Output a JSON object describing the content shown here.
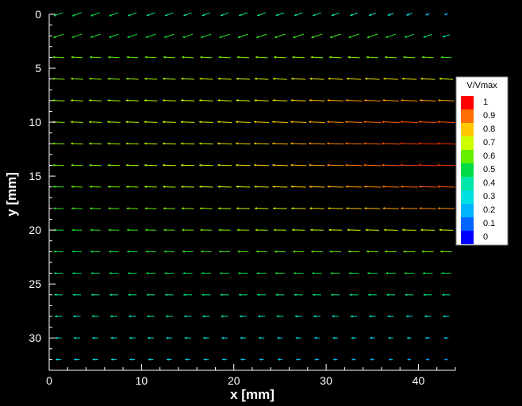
{
  "chart_data": {
    "type": "vector-field",
    "xlabel": "x [mm]",
    "ylabel": "y [mm]",
    "xlim": [
      0,
      44
    ],
    "ylim": [
      33,
      0
    ],
    "x_ticks": [
      0,
      10,
      20,
      30,
      40
    ],
    "y_ticks": [
      0,
      5,
      10,
      15,
      20,
      25,
      30
    ],
    "grid": false,
    "legend": {
      "title": "V/Vmax",
      "placement": "right",
      "levels": [
        "1",
        "0.9",
        "0.8",
        "0.7",
        "0.6",
        "0.5",
        "0.4",
        "0.3",
        "0.2",
        "0.1",
        "0"
      ],
      "colors": [
        "#ff0000",
        "#ff6e00",
        "#ffc800",
        "#ccff00",
        "#66ee00",
        "#00dd44",
        "#00e6aa",
        "#00e0e0",
        "#00b4ff",
        "#0066ff",
        "#0000ff"
      ]
    },
    "grid_x": [
      1,
      3,
      5,
      7,
      9,
      11,
      13,
      15,
      17,
      19,
      21,
      23,
      25,
      27,
      29,
      31,
      33,
      35,
      37,
      39,
      41,
      43
    ],
    "grid_y": [
      0,
      2,
      4,
      6,
      8,
      10,
      12,
      14,
      16,
      18,
      20,
      22,
      24,
      26,
      28,
      30,
      32
    ],
    "direction": "-x",
    "speed_note_rows": [
      [
        0.48,
        0.49,
        0.49,
        0.48,
        0.45,
        0.44,
        0.43,
        0.42,
        0.42,
        0.42,
        0.44,
        0.44,
        0.44,
        0.44,
        0.43,
        0.4,
        0.38,
        0.36,
        0.32,
        0.3,
        0.22,
        0.18
      ],
      [
        0.54,
        0.53,
        0.52,
        0.51,
        0.51,
        0.52,
        0.52,
        0.53,
        0.53,
        0.54,
        0.54,
        0.55,
        0.56,
        0.56,
        0.57,
        0.56,
        0.55,
        0.55,
        0.53,
        0.5,
        0.45,
        0.38
      ],
      [
        0.6,
        0.6,
        0.59,
        0.59,
        0.59,
        0.6,
        0.61,
        0.61,
        0.62,
        0.62,
        0.63,
        0.63,
        0.64,
        0.64,
        0.64,
        0.64,
        0.63,
        0.62,
        0.62,
        0.61,
        0.6,
        0.55
      ],
      [
        0.64,
        0.64,
        0.64,
        0.64,
        0.65,
        0.66,
        0.67,
        0.68,
        0.69,
        0.7,
        0.71,
        0.72,
        0.73,
        0.74,
        0.75,
        0.76,
        0.76,
        0.76,
        0.76,
        0.76,
        0.75,
        0.72
      ],
      [
        0.64,
        0.65,
        0.66,
        0.66,
        0.67,
        0.68,
        0.69,
        0.7,
        0.71,
        0.72,
        0.73,
        0.75,
        0.77,
        0.79,
        0.81,
        0.83,
        0.85,
        0.86,
        0.86,
        0.86,
        0.85,
        0.83
      ],
      [
        0.64,
        0.65,
        0.66,
        0.67,
        0.68,
        0.69,
        0.7,
        0.72,
        0.73,
        0.75,
        0.76,
        0.78,
        0.8,
        0.82,
        0.84,
        0.86,
        0.88,
        0.9,
        0.91,
        0.92,
        0.92,
        0.92
      ],
      [
        0.62,
        0.64,
        0.65,
        0.66,
        0.67,
        0.68,
        0.7,
        0.72,
        0.73,
        0.75,
        0.77,
        0.79,
        0.81,
        0.83,
        0.85,
        0.87,
        0.89,
        0.91,
        0.93,
        0.95,
        0.96,
        0.96
      ],
      [
        0.6,
        0.61,
        0.63,
        0.64,
        0.66,
        0.67,
        0.69,
        0.7,
        0.72,
        0.74,
        0.76,
        0.78,
        0.8,
        0.82,
        0.84,
        0.86,
        0.88,
        0.9,
        0.92,
        0.94,
        0.95,
        0.95
      ],
      [
        0.57,
        0.59,
        0.6,
        0.62,
        0.63,
        0.65,
        0.66,
        0.68,
        0.7,
        0.71,
        0.73,
        0.75,
        0.77,
        0.79,
        0.81,
        0.83,
        0.85,
        0.87,
        0.89,
        0.91,
        0.92,
        0.92
      ],
      [
        0.54,
        0.56,
        0.57,
        0.58,
        0.6,
        0.61,
        0.62,
        0.64,
        0.65,
        0.67,
        0.69,
        0.71,
        0.72,
        0.74,
        0.76,
        0.78,
        0.8,
        0.82,
        0.84,
        0.86,
        0.87,
        0.86
      ],
      [
        0.52,
        0.53,
        0.54,
        0.55,
        0.56,
        0.57,
        0.58,
        0.6,
        0.61,
        0.62,
        0.64,
        0.65,
        0.66,
        0.67,
        0.68,
        0.69,
        0.7,
        0.71,
        0.72,
        0.73,
        0.73,
        0.72
      ],
      [
        0.5,
        0.51,
        0.51,
        0.52,
        0.53,
        0.53,
        0.54,
        0.55,
        0.55,
        0.56,
        0.57,
        0.57,
        0.58,
        0.58,
        0.59,
        0.59,
        0.6,
        0.6,
        0.61,
        0.61,
        0.61,
        0.6
      ],
      [
        0.46,
        0.47,
        0.47,
        0.48,
        0.48,
        0.49,
        0.49,
        0.5,
        0.5,
        0.5,
        0.51,
        0.51,
        0.51,
        0.51,
        0.52,
        0.52,
        0.52,
        0.52,
        0.52,
        0.52,
        0.52,
        0.5
      ],
      [
        0.42,
        0.43,
        0.43,
        0.44,
        0.44,
        0.44,
        0.44,
        0.44,
        0.45,
        0.45,
        0.45,
        0.45,
        0.45,
        0.45,
        0.45,
        0.45,
        0.45,
        0.45,
        0.45,
        0.45,
        0.44,
        0.42
      ],
      [
        0.38,
        0.38,
        0.38,
        0.38,
        0.38,
        0.38,
        0.38,
        0.38,
        0.38,
        0.38,
        0.37,
        0.37,
        0.37,
        0.37,
        0.36,
        0.36,
        0.35,
        0.35,
        0.34,
        0.33,
        0.33,
        0.32
      ],
      [
        0.33,
        0.33,
        0.33,
        0.33,
        0.32,
        0.32,
        0.32,
        0.32,
        0.31,
        0.31,
        0.3,
        0.3,
        0.29,
        0.29,
        0.28,
        0.28,
        0.27,
        0.27,
        0.26,
        0.25,
        0.25,
        0.24
      ],
      [
        0.29,
        0.29,
        0.29,
        0.28,
        0.28,
        0.27,
        0.27,
        0.26,
        0.26,
        0.25,
        0.25,
        0.24,
        0.24,
        0.23,
        0.22,
        0.22,
        0.21,
        0.21,
        0.2,
        0.19,
        0.18,
        0.17
      ]
    ]
  }
}
